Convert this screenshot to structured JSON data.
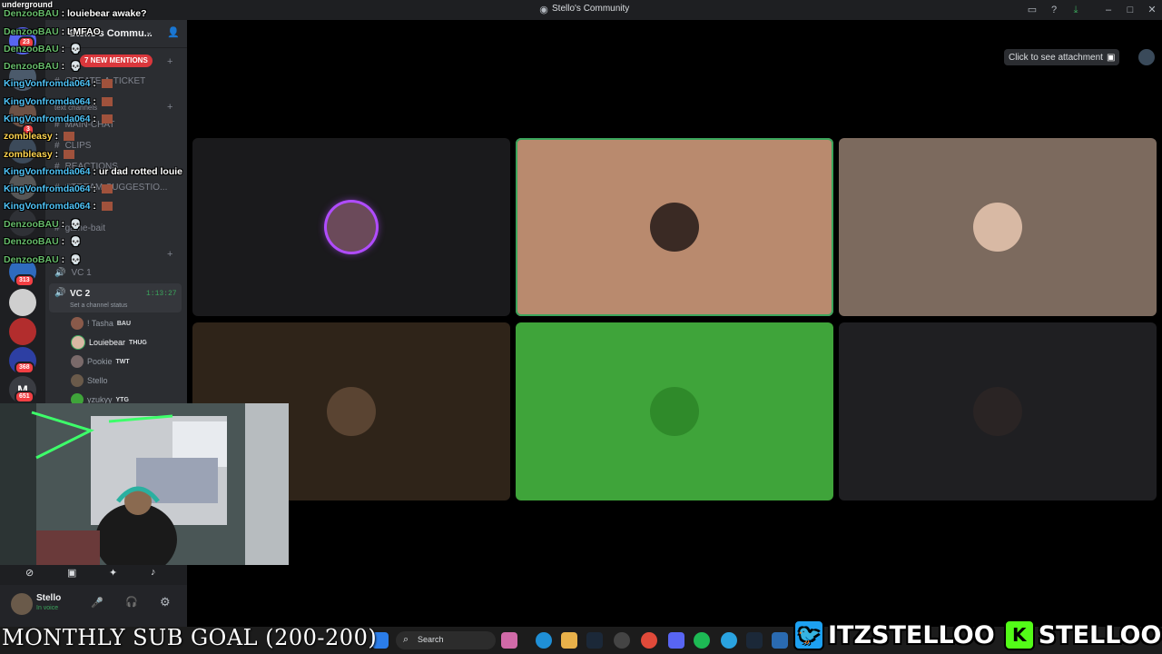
{
  "window": {
    "title": "Stello's Community"
  },
  "overlay_top": {
    "text": "underground"
  },
  "server": {
    "name": "Stello's Commu..."
  },
  "banner": {
    "mentions": "7 NEW MENTIONS"
  },
  "channels": {
    "items": [
      "CREATE-A-TICKET",
      "text channels",
      "MAIN-CHAT",
      "CLIPS",
      "REACTIONS",
      "STREAM-SUGGESTIO...",
      "game-bait"
    ],
    "vc1": "VC 1",
    "vc2": "VC 2",
    "vc2_timer": "1:13:27",
    "vc2_status": "Set a channel status"
  },
  "members": [
    {
      "name": "! Tasha",
      "tag": "BAU"
    },
    {
      "name": "Louiebear",
      "tag": "THUG"
    },
    {
      "name": "Pookie",
      "tag": "TWT"
    },
    {
      "name": "Stello",
      "tag": ""
    },
    {
      "name": "yzukyy",
      "tag": "YTG"
    }
  ],
  "server_badges": [
    "23",
    "3",
    "313",
    "368",
    "651"
  ],
  "user": {
    "name": "Stello",
    "status": "In voice"
  },
  "attachment": {
    "label": "Click to see attachment"
  },
  "chat": [
    {
      "name": "DenzooBAU",
      "msg": "louiebear awake?",
      "color": "green"
    },
    {
      "name": "DenzooBAU",
      "msg": "LMFAO",
      "color": "green"
    },
    {
      "name": "DenzooBAU",
      "msg": "",
      "color": "green",
      "skull": true
    },
    {
      "name": "DenzooBAU",
      "msg": "",
      "color": "green",
      "skull": true
    },
    {
      "name": "KingVonfromda064",
      "msg": "",
      "color": "blue",
      "emote": true
    },
    {
      "name": "KingVonfromda064",
      "msg": "",
      "color": "blue",
      "emote": true
    },
    {
      "name": "KingVonfromda064",
      "msg": "",
      "color": "blue",
      "emote": true
    },
    {
      "name": "zombleasy",
      "msg": "",
      "color": "yellow",
      "emote": true
    },
    {
      "name": "zombleasy",
      "msg": "",
      "color": "yellow",
      "emote": true
    },
    {
      "name": "KingVonfromda064",
      "msg": "ur dad rotted louie",
      "color": "blue"
    },
    {
      "name": "KingVonfromda064",
      "msg": "",
      "color": "blue",
      "emote": true
    },
    {
      "name": "KingVonfromda064",
      "msg": "",
      "color": "blue",
      "emote": true
    },
    {
      "name": "DenzooBAU",
      "msg": "",
      "color": "green",
      "skull": true
    },
    {
      "name": "DenzooBAU",
      "msg": "",
      "color": "green",
      "skull": true
    },
    {
      "name": "DenzooBAU",
      "msg": "",
      "color": "green",
      "skull": true
    }
  ],
  "tiles": [
    {
      "bg": "#1a1a1c",
      "avatar": "#6b4a5a",
      "ring": "#b04cff"
    },
    {
      "bg": "#b98a6e",
      "avatar": "#3a2a24",
      "ring": "#3ba55c"
    },
    {
      "bg": "#7c6a5e",
      "avatar": "#d8b9a4",
      "ring": ""
    },
    {
      "bg": "#2f2419",
      "avatar": "#5a4432",
      "ring": ""
    },
    {
      "bg": "#3fa43a",
      "avatar": "#2f8a2a",
      "ring": ""
    },
    {
      "bg": "#1f1f22",
      "avatar": "#2a2424",
      "ring": ""
    }
  ],
  "overlay": {
    "subgoal": "MONTHLY SUB GOAL (200-200)",
    "twitter": "ITZSTELLOO",
    "kick": "STELLOOO"
  },
  "taskbar": {
    "search": "Search"
  }
}
